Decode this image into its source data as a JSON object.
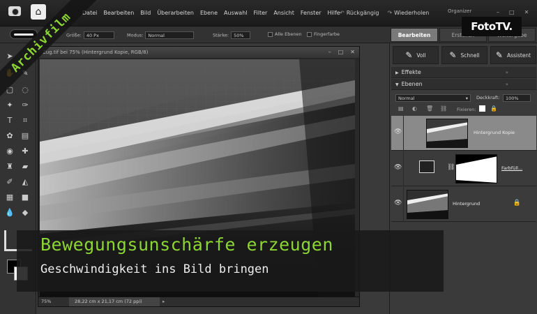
{
  "menubar": {
    "items": [
      "Datei",
      "Bearbeiten",
      "Bild",
      "Überarbeiten",
      "Ebene",
      "Auswahl",
      "Filter",
      "Ansicht",
      "Fenster",
      "Hilfe"
    ],
    "undo_label": "Rückgängig",
    "redo_label": "Wiederholen",
    "organizer_label": "Organizer",
    "window_controls": [
      "–",
      "□",
      "✕"
    ]
  },
  "options_bar": {
    "size_label": "Größe:",
    "size_value": "40 Px",
    "mode_label": "Modus:",
    "mode_value": "Normal",
    "strength_label": "Stärke:",
    "strength_value": "50%",
    "all_layers_label": "Alle Ebenen",
    "finger_paint_label": "Fingerfarbe"
  },
  "mode_tabs": [
    "Bearbeiten",
    "Erstellen",
    "Weitergabe"
  ],
  "edit_subtabs": [
    "Voll",
    "Schnell",
    "Assistent"
  ],
  "document": {
    "title": "Zug.tif bei 75% (Hintergrund Kopie, RGB/8)",
    "zoom": "75%",
    "dimensions": "28,22 cm x 21,17 cm (72 ppi)",
    "controls": [
      "–",
      "□",
      "✕"
    ]
  },
  "panels": {
    "effects_label": "Effekte",
    "layers_label": "Ebenen",
    "blend_mode": "Normal",
    "opacity_label": "Deckkraft:",
    "opacity_value": "100%",
    "fixing_label": "Fixieren:"
  },
  "layers": [
    {
      "name": "Hintergrund Kopie",
      "selected": true
    },
    {
      "name": "Farbfüll...",
      "selected": false
    },
    {
      "name": "Hintergrund",
      "selected": false,
      "locked": true
    }
  ],
  "branding": {
    "archive_label": "Archivfilm",
    "logo": "FotoTV."
  },
  "lower_third": {
    "title": "Bewegungsunschärfe erzeugen",
    "subtitle": "Geschwindigkeit ins Bild bringen"
  },
  "colors": {
    "accent_green": "#8cd634",
    "background": "#3a3a3a"
  }
}
